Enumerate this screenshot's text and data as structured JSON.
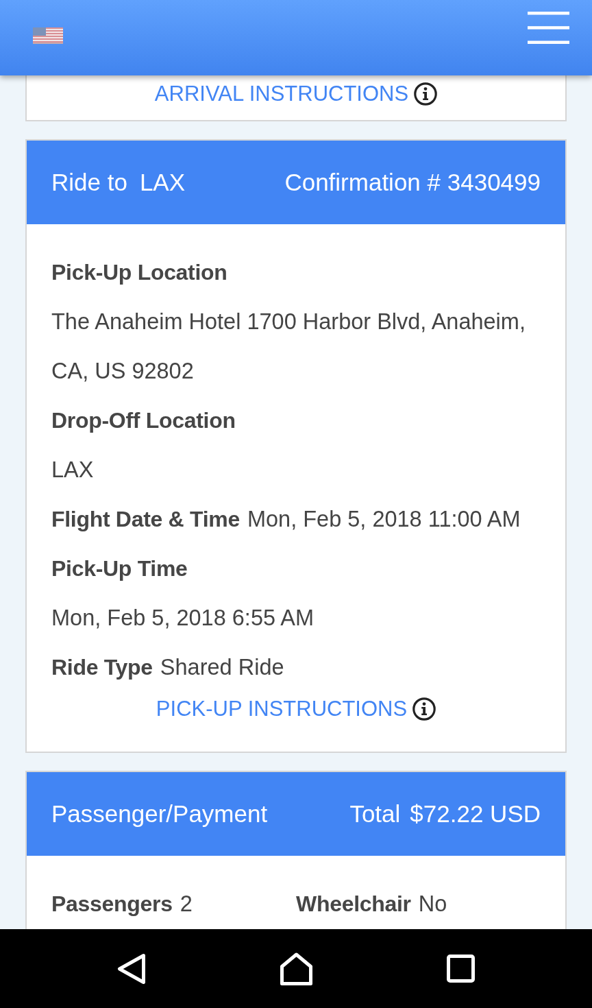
{
  "arrival_card": {
    "instructions_link": "ARRIVAL INSTRUCTIONS"
  },
  "ride_card": {
    "title": "Ride to",
    "destination": "LAX",
    "confirmation": "Confirmation # 3430499",
    "fields": [
      {
        "kind": "block",
        "label": "Pick-Up Location",
        "value": "The Anaheim Hotel 1700 Harbor Blvd, Anaheim, CA, US 92802"
      },
      {
        "kind": "block",
        "label": "Drop-Off Location",
        "value": "LAX"
      },
      {
        "kind": "inline",
        "label": "Flight Date & Time",
        "value": "Mon, Feb 5, 2018 11:00 AM"
      },
      {
        "kind": "block",
        "label": "Pick-Up Time",
        "value": "Mon, Feb 5, 2018 6:55 AM"
      },
      {
        "kind": "inline",
        "label": "Ride Type",
        "value": "Shared Ride"
      }
    ],
    "instructions_link": "PICK-UP INSTRUCTIONS"
  },
  "payment_card": {
    "title": "Passenger/Payment",
    "total_label": "Total",
    "total": "$72.22 USD",
    "fields": [
      {
        "label": "Passengers",
        "value": "2"
      },
      {
        "label": "Wheelchair",
        "value": "No"
      }
    ]
  }
}
